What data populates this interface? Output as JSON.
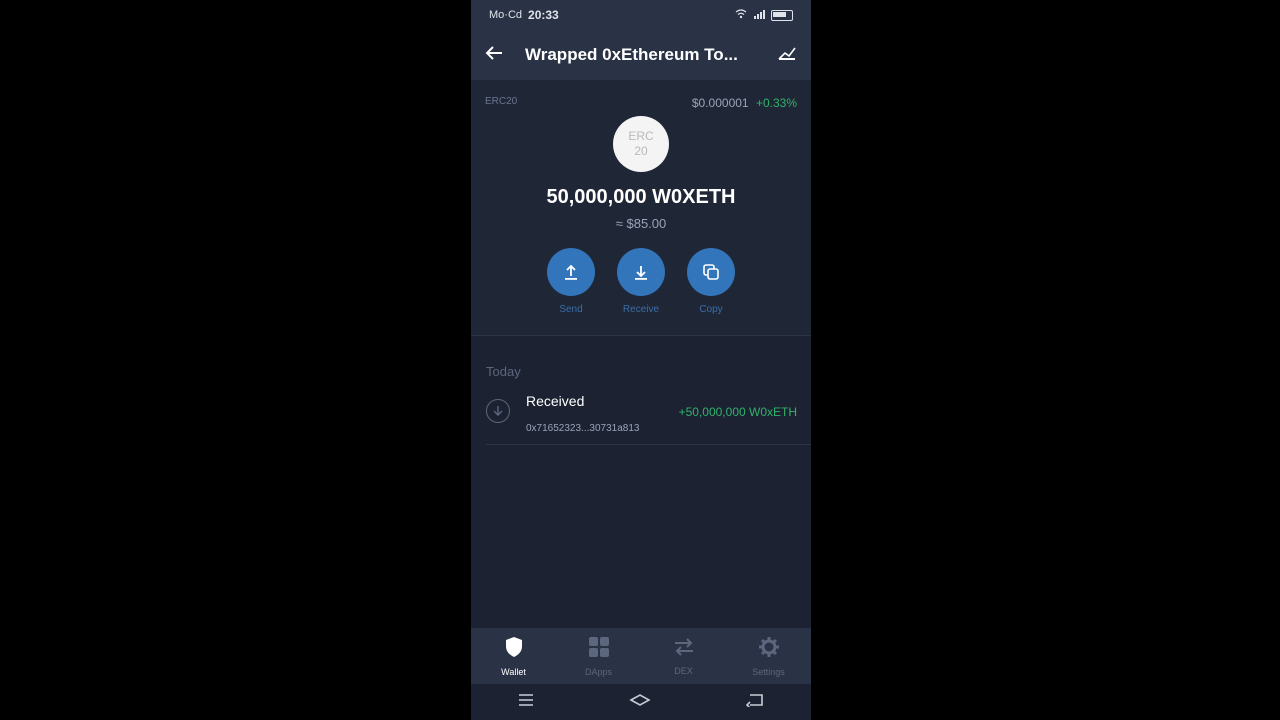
{
  "statusbar": {
    "left_text": "Mo·Cd",
    "time": "20:33"
  },
  "appbar": {
    "title": "Wrapped 0xEthereum To..."
  },
  "token": {
    "standard": "ERC20",
    "price": "$0.000001",
    "change": "+0.33%",
    "logo_line1": "ERC",
    "logo_line2": "20",
    "balance": "50,000,000 W0XETH",
    "fiat": "≈ $85.00"
  },
  "actions": [
    {
      "label": "Send",
      "icon": "upload-icon"
    },
    {
      "label": "Receive",
      "icon": "download-icon"
    },
    {
      "label": "Copy",
      "icon": "copy-icon"
    }
  ],
  "transactions": {
    "section_title": "Today",
    "items": [
      {
        "type": "Received",
        "address": "0x71652323...30731a813",
        "amount": "+50,000,000 W0xETH"
      }
    ]
  },
  "bottom_nav": [
    {
      "label": "Wallet",
      "icon": "shield-icon",
      "active": true
    },
    {
      "label": "DApps",
      "icon": "grid-icon",
      "active": false
    },
    {
      "label": "DEX",
      "icon": "swap-icon",
      "active": false
    },
    {
      "label": "Settings",
      "icon": "gear-icon",
      "active": false
    }
  ],
  "colors": {
    "accent": "#3375bb",
    "positive": "#2fb36b",
    "background": "#1c2231",
    "bar": "#2a3346"
  }
}
